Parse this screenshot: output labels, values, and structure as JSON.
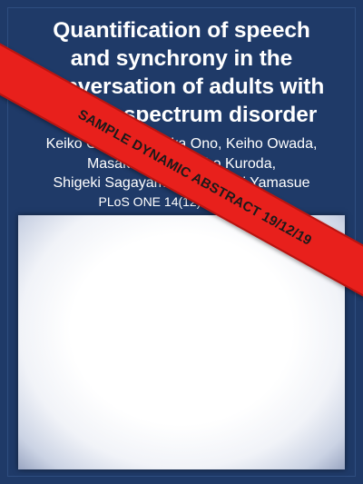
{
  "card": {
    "title_lines": [
      "Quantification of speech",
      "and synchrony in the",
      "conversation of adults with",
      "autism spectrum disorder"
    ],
    "author_lines": [
      "Keiko Ochi, Nobutaka Ono, Keiho Owada,",
      "Masaki Kojima, Miho Kuroda,",
      "Shigeki Sagayama & Hidenori Yamasue"
    ],
    "citation": "PLoS ONE 14(12): e0225377"
  },
  "banner": {
    "text": "SAMPLE DYNAMIC ABSTRACT 19/12/19"
  },
  "colors": {
    "background": "#1f3a68",
    "banner": "#e8201c",
    "text": "#ffffff"
  }
}
